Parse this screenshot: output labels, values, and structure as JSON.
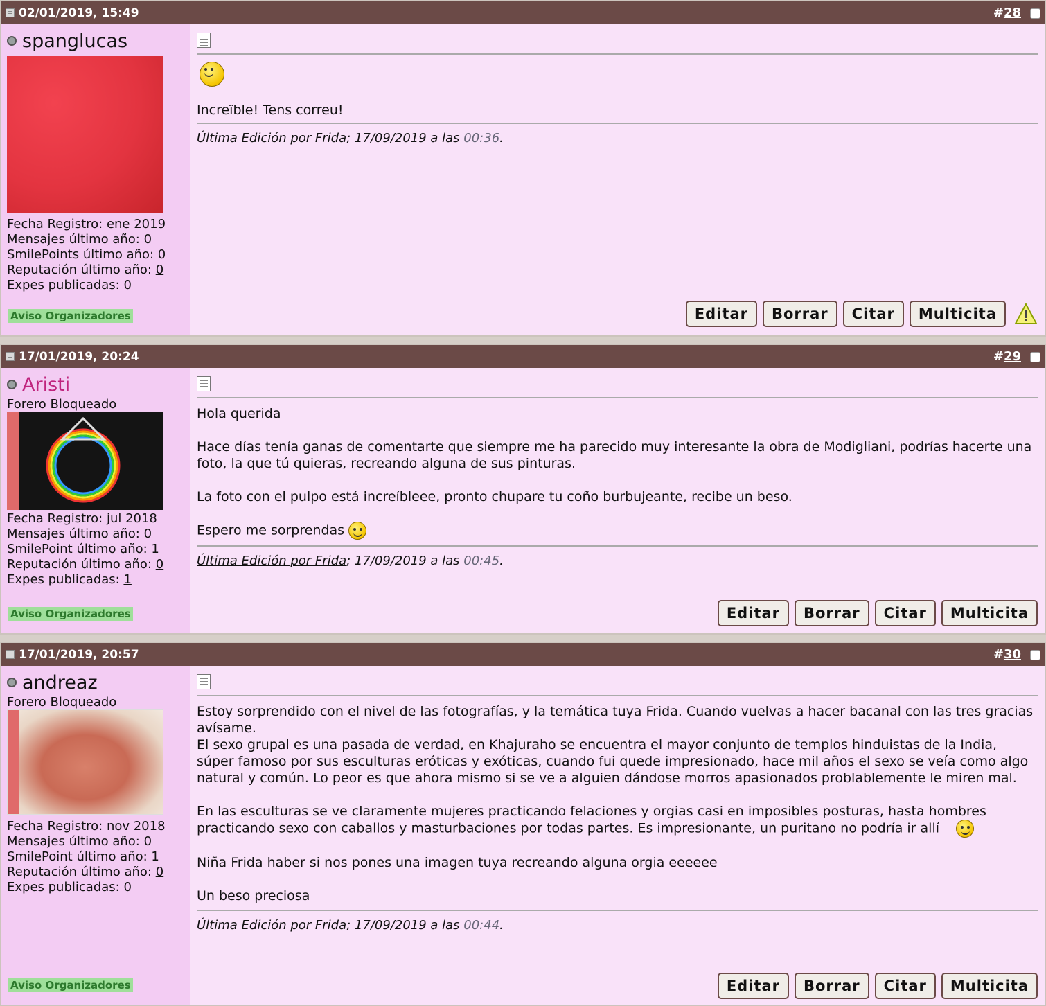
{
  "posts": [
    {
      "date": "02/01/2019, 15:49",
      "number": "28",
      "username": "spanglucas",
      "user_title": "",
      "stats": {
        "registro": "Fecha Registro: ene 2019",
        "mensajes": "Mensajes último año: 0",
        "smilepoints": "SmilePoints último año: 0",
        "reputacion_label": "Reputación último año: ",
        "reputacion_value": "0",
        "expes_label": "Expes publicadas: ",
        "expes_value": "0"
      },
      "aviso": "Aviso Organizadores",
      "message": [
        "Increïble! Tens correu!"
      ],
      "edit": {
        "by": "Última Edición por Frida",
        "date": "; 17/09/2019 a las ",
        "time": "00:36",
        "end": "."
      }
    },
    {
      "date": "17/01/2019, 20:24",
      "number": "29",
      "username": "Aristi",
      "user_title": "Forero Bloqueado",
      "stats": {
        "registro": "Fecha Registro: jul 2018",
        "mensajes": "Mensajes último año: 0",
        "smilepoints": "SmilePoint último año: 1",
        "reputacion_label": "Reputación último año: ",
        "reputacion_value": "0",
        "expes_label": "Expes publicadas: ",
        "expes_value": "1"
      },
      "aviso": "Aviso Organizadores",
      "message": [
        "Hola querida",
        "Hace días tenía ganas de comentarte que siempre me ha parecido muy interesante la obra de Modigliani, podrías hacerte una foto, la que tú quieras, recreando alguna de sus pinturas.",
        "La foto con el pulpo está increíbleee, pronto chupare tu coño burbujeante, recibe un beso.",
        "Espero me sorprendas"
      ],
      "edit": {
        "by": "Última Edición por Frida",
        "date": "; 17/09/2019 a las ",
        "time": "00:45",
        "end": "."
      }
    },
    {
      "date": "17/01/2019, 20:57",
      "number": "30",
      "username": "andreaz",
      "user_title": "Forero Bloqueado",
      "stats": {
        "registro": "Fecha Registro: nov 2018",
        "mensajes": "Mensajes último año: 0",
        "smilepoints": "SmilePoint último año: 1",
        "reputacion_label": "Reputación último año: ",
        "reputacion_value": "0",
        "expes_label": "Expes publicadas: ",
        "expes_value": "0"
      },
      "aviso": "Aviso Organizadores",
      "message": [
        "Estoy sorprendido con el nivel de las fotografías, y la temática tuya Frida. Cuando vuelvas a hacer bacanal con las tres gracias avísame.",
        "El sexo grupal es una pasada de verdad, en Khajuraho se encuentra el mayor conjunto de templos hinduistas de la India, súper famoso por sus esculturas eróticas y exóticas, cuando fui quede impresionado, hace mil años el sexo se veía como algo natural y común. Lo peor es que ahora mismo si se ve a alguien dándose morros apasionados problablemente le miren mal.",
        "En las esculturas se ve claramente mujeres practicando felaciones y orgias casi en imposibles posturas, hasta hombres practicando sexo con caballos y masturbaciones por todas partes. Es impresionante, un puritano no podría ir allí",
        "Niña Frida haber si nos pones una imagen tuya recreando alguna orgia eeeeee",
        "Un beso preciosa"
      ],
      "edit": {
        "by": "Última Edición por Frida",
        "date": "; 17/09/2019 a las ",
        "time": "00:44",
        "end": "."
      }
    }
  ],
  "buttons": {
    "edit": "Editar",
    "delete": "Borrar",
    "quote": "Citar",
    "multiquote": "Multicita"
  },
  "colors": {
    "header_bg": "#6b4a47",
    "user_col_bg": "#f3ccf3",
    "content_bg": "#f9e2f9",
    "username_pink": "#c0257e",
    "aviso_bg": "#9fdf9a"
  }
}
